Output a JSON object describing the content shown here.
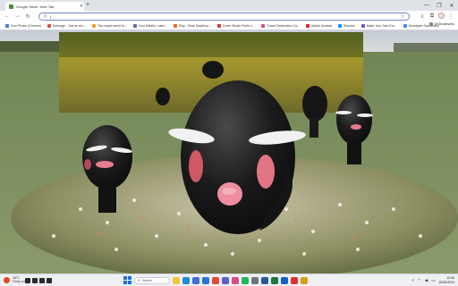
{
  "browser": {
    "tab": {
      "title": "Google Saver: New Tab",
      "favicon": "leaf-icon"
    },
    "new_tab_icon": "+",
    "window_controls": [
      "—",
      "❐",
      "✕"
    ],
    "address_bar": {
      "value": "|",
      "icon": "site-info-icon"
    },
    "toolbar_icons": [
      "star-icon",
      "download-icon",
      "extensions-icon",
      "profile-avatar",
      "menu-icon"
    ],
    "bookmarks": [
      {
        "label": "Your Phone (Chrome)",
        "color": "#3b7be0"
      },
      {
        "label": "Deezage - Just an em...",
        "color": "#e04a4a"
      },
      {
        "label": "The crypto world fo...",
        "color": "#f29d1f"
      },
      {
        "label": "Your Details | catm...",
        "color": "#5a6f8f"
      },
      {
        "label": "Etsy - Shop Dashboa...",
        "color": "#f1641e"
      },
      {
        "label": "Cover Studio Public L...",
        "color": "#e03434"
      },
      {
        "label": "Travel Destination Ca...",
        "color": "#d94e7b"
      },
      {
        "label": "Adobe Acrobat",
        "color": "#e02020"
      },
      {
        "label": "Shazam",
        "color": "#0f8fff"
      },
      {
        "label": "Make Your Own Em...",
        "color": "#6a5acd"
      },
      {
        "label": "Developer Dashboard",
        "color": "#4285f4"
      }
    ],
    "all_bookmarks_label": "All Bookmarks"
  },
  "taskbar": {
    "weather": {
      "temp": "16°C",
      "desc": "Partly sunny"
    },
    "search_placeholder": "Search",
    "apps": [
      {
        "name": "file-explorer-icon",
        "color": "#f5c542"
      },
      {
        "name": "edge-icon",
        "color": "#1c8bd9"
      },
      {
        "name": "store-icon",
        "color": "#3b6ee0"
      },
      {
        "name": "mail-icon",
        "color": "#2a74d6"
      },
      {
        "name": "chrome-icon",
        "color": "#e24a3a"
      },
      {
        "name": "teams-icon",
        "color": "#5b5fc7"
      },
      {
        "name": "photos-icon",
        "color": "#d84b8a"
      },
      {
        "name": "spotify-icon",
        "color": "#1db954"
      },
      {
        "name": "settings-icon",
        "color": "#6c7480"
      },
      {
        "name": "word-icon",
        "color": "#2b5797"
      },
      {
        "name": "excel-icon",
        "color": "#217346"
      },
      {
        "name": "outlook-icon",
        "color": "#0a64c2"
      },
      {
        "name": "app-red-icon",
        "color": "#d9342b"
      },
      {
        "name": "app-gold-icon",
        "color": "#d4a017"
      }
    ],
    "clock": {
      "time": "10:06",
      "date": "18/05/2024"
    }
  }
}
